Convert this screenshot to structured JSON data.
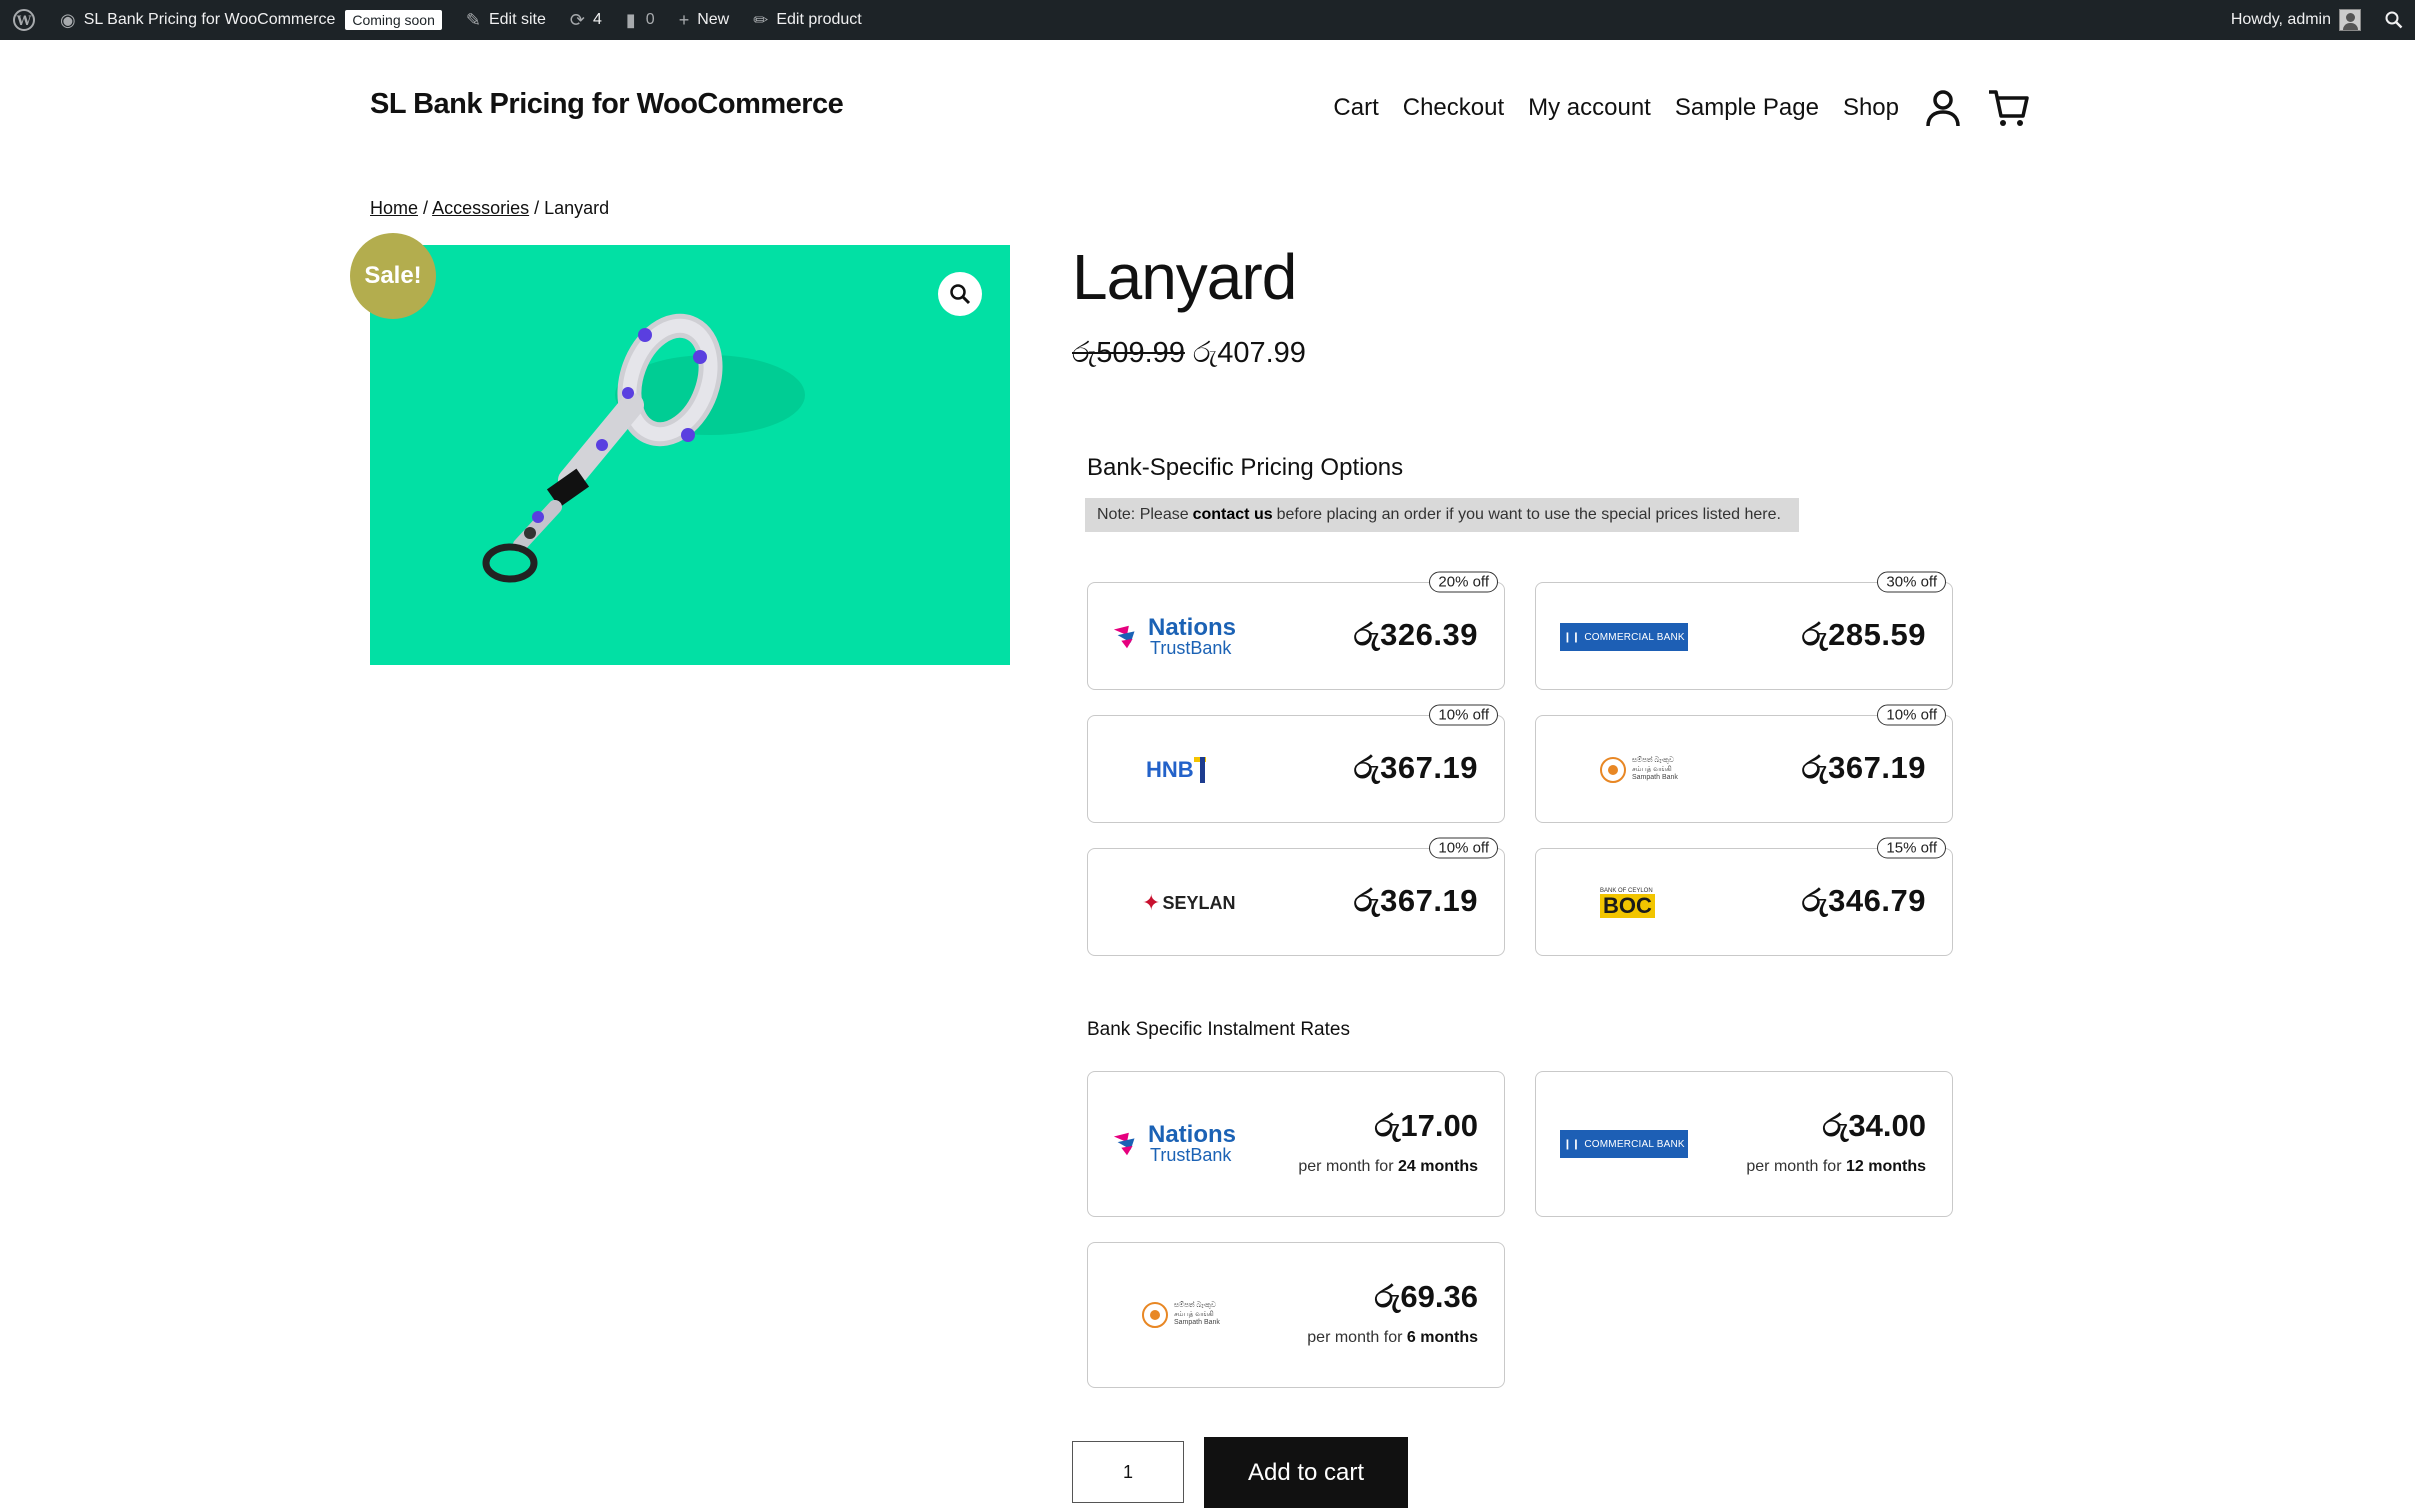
{
  "admin_bar": {
    "site_name": "SL Bank Pricing for WooCommerce",
    "coming_soon": "Coming soon",
    "edit_site": "Edit site",
    "updates_count": "4",
    "comments_count": "0",
    "new_label": "New",
    "edit_product": "Edit product",
    "howdy": "Howdy, admin"
  },
  "header": {
    "site_title": "SL Bank Pricing for WooCommerce",
    "nav": [
      "Cart",
      "Checkout",
      "My account",
      "Sample Page",
      "Shop"
    ]
  },
  "breadcrumb": {
    "home": "Home",
    "sep": "/",
    "category": "Accessories",
    "current": "Lanyard"
  },
  "product": {
    "sale_badge": "Sale!",
    "title": "Lanyard",
    "regular_price": "රු509.99",
    "sale_price": "රු407.99",
    "quantity": "1",
    "add_to_cart": "Add to cart"
  },
  "bank_pricing": {
    "heading": "Bank-Specific Pricing Options",
    "note_prefix": "Note: Please",
    "note_link": "contact us",
    "note_suffix": "before placing an order if you want to use the special prices listed here.",
    "cards": [
      {
        "bank": "Nations TrustBank",
        "discount": "20% off",
        "price": "රු326.39"
      },
      {
        "bank": "Commercial Bank",
        "discount": "30% off",
        "price": "රු285.59"
      },
      {
        "bank": "HNB",
        "discount": "10% off",
        "price": "රු367.19"
      },
      {
        "bank": "Sampath Bank",
        "discount": "10% off",
        "price": "රු367.19"
      },
      {
        "bank": "Seylan",
        "discount": "10% off",
        "price": "රු367.19"
      },
      {
        "bank": "BOC",
        "discount": "15% off",
        "price": "රු346.79"
      }
    ]
  },
  "instalments": {
    "heading": "Bank Specific Instalment Rates",
    "per_month_for": "per month for",
    "cards": [
      {
        "bank": "Nations TrustBank",
        "amount": "රු17.00",
        "months": "24 months"
      },
      {
        "bank": "Commercial Bank",
        "amount": "රු34.00",
        "months": "12 months"
      },
      {
        "bank": "Sampath Bank",
        "amount": "රු69.36",
        "months": "6 months"
      }
    ]
  },
  "logos": {
    "ntb_line1": "Nations",
    "ntb_line2": "TrustBank",
    "commercial": "COMMERCIAL BANK",
    "hnb": "HNB",
    "sampath_line1": "සම්පත් බැංකුව",
    "sampath_line2": "சம்பத் வங்கி",
    "sampath_line3": "Sampath Bank",
    "seylan": "SEYLAN",
    "boc_top": "BANK OF CEYLON",
    "boc": "BOC"
  },
  "colors": {
    "image_bg": "#02e0a4",
    "sale_badge": "#b3ad4e",
    "admin_bar": "#1d2327",
    "button": "#111111"
  }
}
